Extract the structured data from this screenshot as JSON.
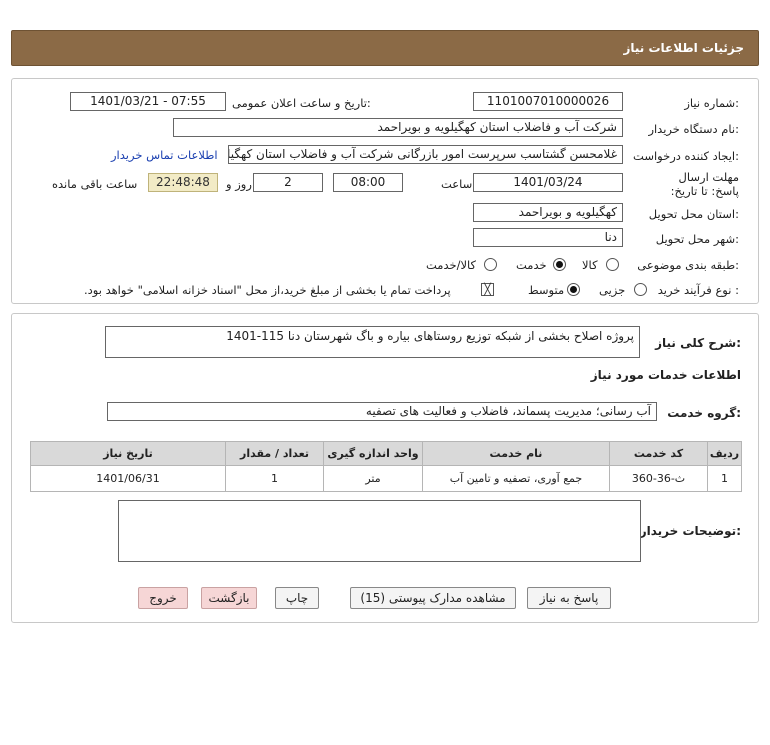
{
  "header": {
    "title": "جزئیات اطلاعات نیاز"
  },
  "need_info": {
    "need_number_label": "شماره نیاز:",
    "need_number": "1101007010000026",
    "announce_label": "تاریخ و ساعت اعلان عمومی:",
    "announce_value": "1401/03/21 - 07:55",
    "buyer_org_label": "نام دستگاه خریدار:",
    "buyer_org": "شرکت آب و فاضلاب استان کهگیلویه و بویراحمد",
    "requester_label": "ایجاد کننده درخواست:",
    "requester": "غلامحسن گشتاسب سرپرست امور بازرگانی شرکت آب و فاضلاب استان کهگیلویه و بویراحمد",
    "contact_link": "اطلاعات تماس خریدار",
    "deadline_label": "مهلت ارسال پاسخ: تا تاریخ:",
    "deadline_date": "1401/03/24",
    "time_label": "ساعت",
    "deadline_time": "08:00",
    "days_value": "2",
    "days_label": "روز و",
    "remaining_time": "22:48:48",
    "remaining_label": "ساعت باقی مانده",
    "province_label": "استان محل تحویل:",
    "province": "کهگیلویه و بویراحمد",
    "city_label": "شهر محل تحویل:",
    "city": "دنا",
    "category_label": "طبقه بندی موضوعی:",
    "category_options": [
      "کالا",
      "خدمت",
      "کالا/خدمت"
    ],
    "category_selected": "خدمت",
    "process_label": "نوع فرآیند خرید :",
    "process_options": [
      "جزیی",
      "متوسط"
    ],
    "process_selected": "متوسط",
    "payment_note": "پرداخت تمام یا بخشی از مبلغ خرید،از محل \"اسناد خزانه اسلامی\" خواهد بود."
  },
  "details": {
    "summary_label": "شرح کلی نیاز:",
    "summary": "پروژه اصلاح بخشی از شبکه توزیع روستاهای بیاره و باگ شهرستان دنا 115-1401",
    "services_heading": "اطلاعات خدمات مورد نیاز",
    "service_group_label": "گروه خدمت:",
    "service_group": "آب رسانی؛ مدیریت پسماند، فاضلاب و فعالیت های تصفیه",
    "table": {
      "headers": [
        "ردیف",
        "کد خدمت",
        "نام خدمت",
        "واحد اندازه گیری",
        "تعداد / مقدار",
        "تاریخ نیاز"
      ],
      "rows": [
        [
          "1",
          "ث-36-360",
          "جمع آوری، تصفیه و تامین آب",
          "متر",
          "1",
          "1401/06/31"
        ]
      ]
    },
    "buyer_notes_label": "توضیحات خریدار:",
    "buyer_notes": ""
  },
  "buttons": {
    "reply": "پاسخ به نیاز",
    "attachments": "مشاهده مدارک پیوستی (15)",
    "print": "چاپ",
    "back": "بازگشت",
    "exit": "خروج"
  }
}
